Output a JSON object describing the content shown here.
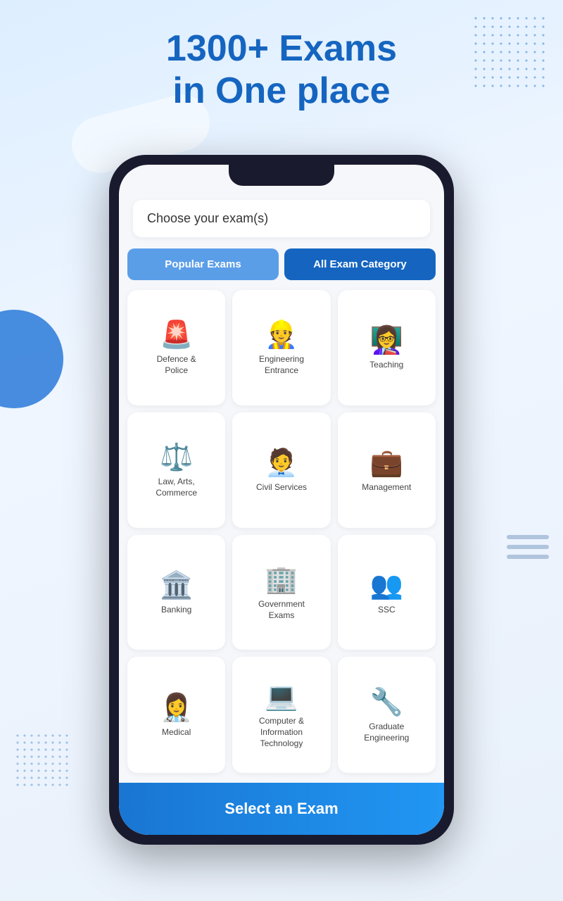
{
  "header": {
    "line1": "1300+ Exams",
    "line2": "in One place"
  },
  "tabs": {
    "popular": "Popular Exams",
    "all_category": "All Exam Category"
  },
  "choose_label": "Choose your exam(s)",
  "select_btn": "Select an Exam",
  "categories": [
    {
      "id": "defence-police",
      "label": "Defence &\nPolice",
      "icon": "🚨"
    },
    {
      "id": "engineering-entrance",
      "label": "Engineering\nEntrance",
      "icon": "👷"
    },
    {
      "id": "teaching",
      "label": "Teaching",
      "icon": "👩‍🏫"
    },
    {
      "id": "law-arts-commerce",
      "label": "Law, Arts,\nCommerce",
      "icon": "⚖️"
    },
    {
      "id": "civil-services",
      "label": "Civil Services",
      "icon": "🧑‍💼"
    },
    {
      "id": "management",
      "label": "Management",
      "icon": "💼"
    },
    {
      "id": "banking",
      "label": "Banking",
      "icon": "🏛️"
    },
    {
      "id": "government-exams",
      "label": "Government\nExams",
      "icon": "🏢"
    },
    {
      "id": "ssc",
      "label": "SSC",
      "icon": "👥"
    },
    {
      "id": "medical",
      "label": "Medical",
      "icon": "👩‍⚕️"
    },
    {
      "id": "computer-it",
      "label": "Computer &\nInformation\nTechnology",
      "icon": "💻"
    },
    {
      "id": "graduate-engineering",
      "label": "Graduate\nEngineering",
      "icon": "🔧"
    }
  ]
}
